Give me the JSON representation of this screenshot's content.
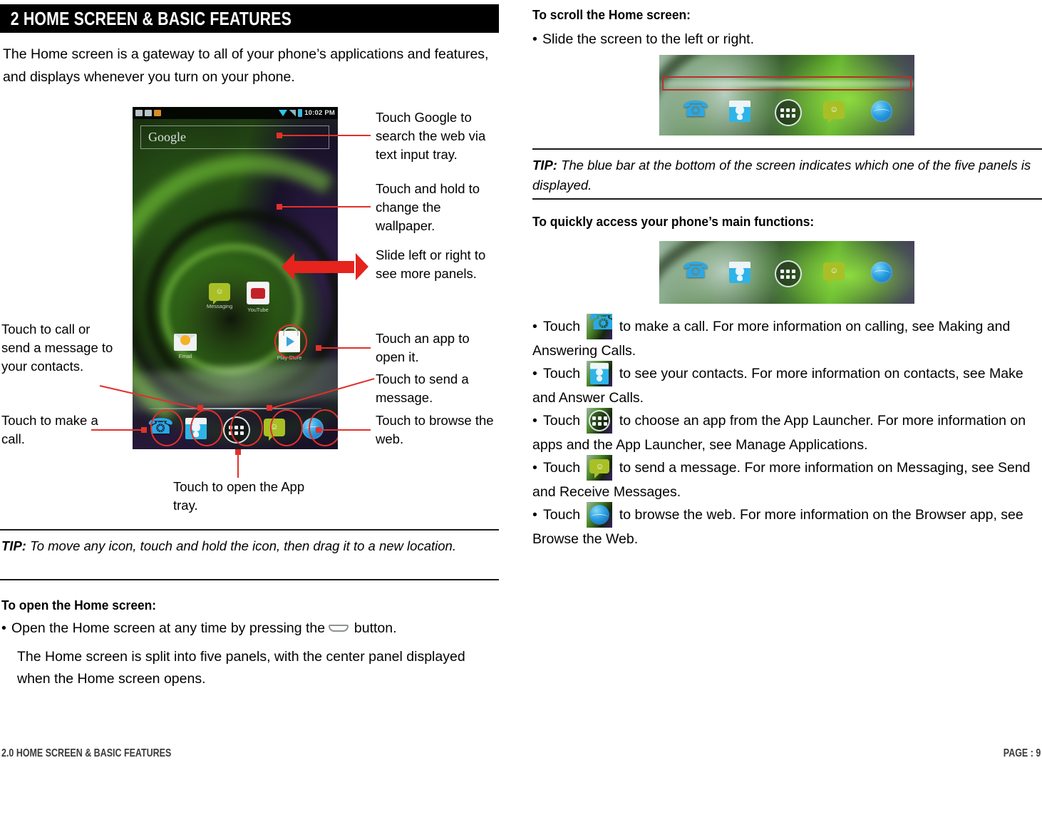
{
  "chapter": {
    "title": "2 HOME SCREEN & BASIC FEATURES",
    "intro": "The Home screen is a gateway to all of your phone’s applications and features, and displays whenever you turn on your phone."
  },
  "phone": {
    "status_bar": {
      "time": "10:02 PM",
      "icons": [
        "sms-icon",
        "sd-card-icon",
        "download-icon",
        "wifi-icon",
        "signal-icon",
        "battery-icon"
      ]
    },
    "search_box": {
      "label": "Google"
    },
    "apps": [
      {
        "name": "Messaging",
        "icon": "messaging-icon"
      },
      {
        "name": "YouTube",
        "icon": "youtube-icon"
      },
      {
        "name": "Email",
        "icon": "email-icon"
      },
      {
        "name": "Play Store",
        "icon": "play-store-icon"
      }
    ],
    "dock": [
      {
        "name": "Phone",
        "icon": "phone-icon"
      },
      {
        "name": "Contacts",
        "icon": "contacts-icon"
      },
      {
        "name": "App tray",
        "icon": "launcher-icon"
      },
      {
        "name": "Messaging",
        "icon": "message-icon"
      },
      {
        "name": "Browser",
        "icon": "browser-icon"
      }
    ]
  },
  "callouts": {
    "google": "Touch Google to search the web via text input tray.",
    "wallpaper": "Touch and hold to change the wallpaper.",
    "slide": "Slide left or right to see more panels.",
    "app_open": "Touch an app to open it.",
    "send_message": "Touch to send a message.",
    "browse_web": "Touch to browse the web.",
    "contacts": "Touch to call or send a message to your contacts.",
    "make_call": "Touch to make a call.",
    "app_tray": "Touch to open the App tray."
  },
  "left_tip": {
    "label": "TIP:",
    "text": " To move any icon, touch and hold the icon, then drag it to a new location."
  },
  "open_home": {
    "heading": "To open the Home screen:",
    "bullet_before": "Open the Home screen at any time by pressing the ",
    "bullet_after": " button.",
    "paragraph": "The Home screen is split into five panels, with the center panel displayed when the Home screen opens."
  },
  "scroll_home": {
    "heading": "To scroll the Home screen:",
    "bullet": "Slide the screen to the left or right."
  },
  "right_tip": {
    "label": "TIP:",
    "text": " The blue bar at the bottom of the screen indicates which one of the five panels is displayed."
  },
  "quick_access": {
    "heading": "To quickly access your phone’s main functions:",
    "bullets": [
      {
        "icon": "phone-icon",
        "before": "Touch ",
        "after": " to make a call. For more information on calling, see Making and Answering Calls."
      },
      {
        "icon": "contacts-icon",
        "before": "Touch ",
        "after": " to see your contacts. For more information on contacts, see Make and Answer Calls."
      },
      {
        "icon": "launcher-icon",
        "before": "Touch ",
        "after": " to choose an app from the App Launcher. For more information on apps and the App Launcher, see Manage Applications."
      },
      {
        "icon": "message-icon",
        "before": "Touch ",
        "after": " to send a message. For more information on Messaging, see Send and Receive Messages."
      },
      {
        "icon": "browser-icon",
        "before": "Touch ",
        "after": " to browse the web. For more information on the Browser app, see Browse the Web."
      }
    ]
  },
  "footer": {
    "left": "2.0 HOME SCREEN & BASIC FEATURES",
    "right": "PAGE : 9"
  },
  "colors": {
    "annotation_red": "#e0312a",
    "arrow_red": "#e4241d",
    "header_black": "#000000",
    "footer_gray": "#3b3b3b"
  }
}
